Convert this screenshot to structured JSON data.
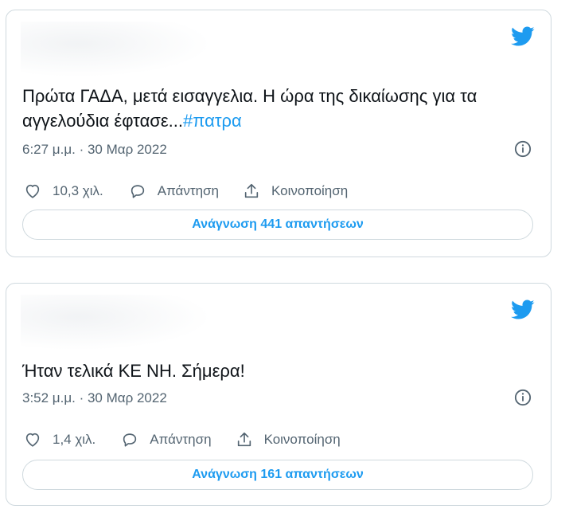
{
  "colors": {
    "accent": "#1d9bf0",
    "text": "#0f1419",
    "muted": "#536471",
    "border": "#cfd9de"
  },
  "tweets": [
    {
      "text_main": "Πρώτα ΓΑΔΑ, μετά εισαγγελια. Η ώρα της δικαίωσης για τα αγγελούδια έφτασε...",
      "hashtag": "#πατρα",
      "timestamp": "6:27 μ.μ. · 30 Μαρ 2022",
      "likes": "10,3 χιλ.",
      "reply_label": "Απάντηση",
      "share_label": "Κοινοποίηση",
      "read_replies_label": "Ανάγνωση 441 απαντήσεων",
      "icons": [
        "twitter-bird-icon",
        "info-icon",
        "heart-icon",
        "reply-icon",
        "share-icon"
      ]
    },
    {
      "text_main": "Ήταν τελικά ΚΕ ΝΗ. Σήμερα!",
      "hashtag": "",
      "timestamp": "3:52 μ.μ. · 30 Μαρ 2022",
      "likes": "1,4 χιλ.",
      "reply_label": "Απάντηση",
      "share_label": "Κοινοποίηση",
      "read_replies_label": "Ανάγνωση 161 απαντήσεων",
      "icons": [
        "twitter-bird-icon",
        "info-icon",
        "heart-icon",
        "reply-icon",
        "share-icon"
      ]
    }
  ]
}
